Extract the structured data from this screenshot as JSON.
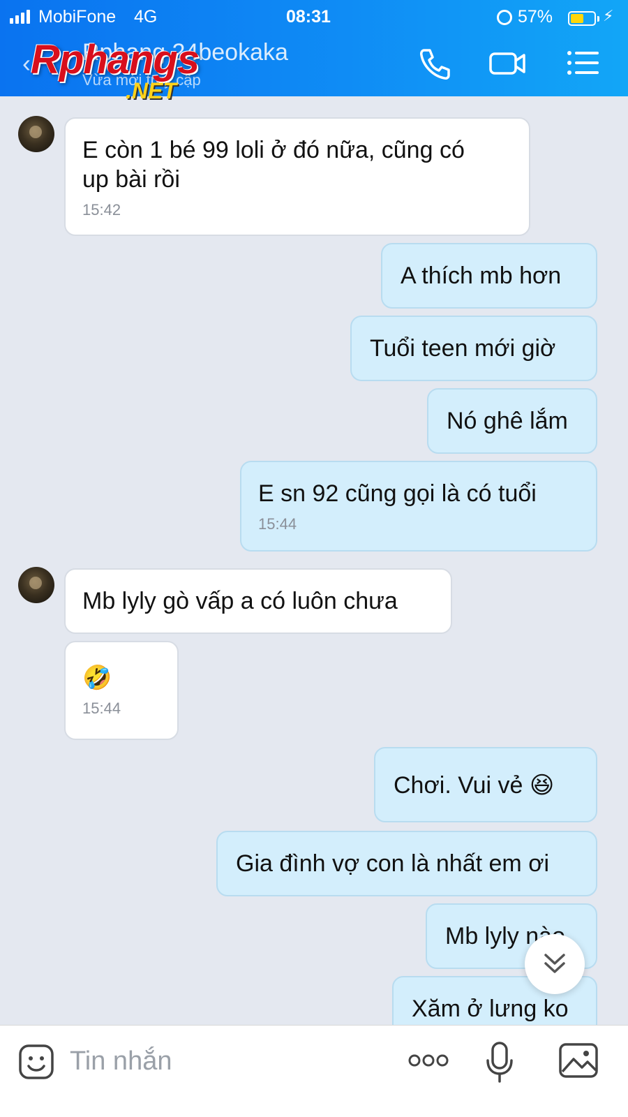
{
  "status_bar": {
    "carrier": "MobiFone",
    "network": "4G",
    "time": "08:31",
    "battery_percent": "57%",
    "battery_level": 0.57,
    "battery_color": "#ffd60a"
  },
  "header": {
    "back_icon": "chevron-left-icon",
    "contact_name": "Rphang 24beokaka",
    "status_text": "Vừa mới truy cập",
    "watermark_logo": "Rphangs",
    "watermark_suffix": ".NET",
    "icons": [
      "phone-icon",
      "video-camera-icon",
      "menu-list-icon"
    ]
  },
  "messages": [
    {
      "direction": "incoming",
      "text": "E còn 1 bé 99 loli ở đó nữa, cũng có\nup bài rồi",
      "time": "15:42"
    },
    {
      "direction": "outgoing",
      "text": "A thích mb hơn"
    },
    {
      "direction": "outgoing",
      "text": "Tuổi teen mới giờ"
    },
    {
      "direction": "outgoing",
      "text": "Nó ghê lắm"
    },
    {
      "direction": "outgoing",
      "text": "E sn 92 cũng gọi là có tuổi",
      "time": "15:44"
    },
    {
      "direction": "incoming",
      "text": "Mb lyly gò vấp a có luôn chưa"
    },
    {
      "direction": "incoming",
      "text": "🤣",
      "time": "15:44"
    },
    {
      "direction": "outgoing",
      "text": "Chơi. Vui vẻ 😆"
    },
    {
      "direction": "outgoing",
      "text": "Gia đình vợ con là nhất em ơi"
    },
    {
      "direction": "outgoing",
      "text": "Mb lyly nào"
    },
    {
      "direction": "outgoing",
      "text": "Xăm ở lưng ko"
    }
  ],
  "composer": {
    "placeholder": "Tin nhắn",
    "icons": [
      "sticker-icon",
      "more-options-icon",
      "microphone-icon",
      "photo-icon"
    ]
  },
  "colors": {
    "header_blue": "#0f8cf5",
    "outgoing_bubble": "#d3eefc",
    "incoming_bubble": "#ffffff",
    "chat_background": "#e4e8f0"
  }
}
